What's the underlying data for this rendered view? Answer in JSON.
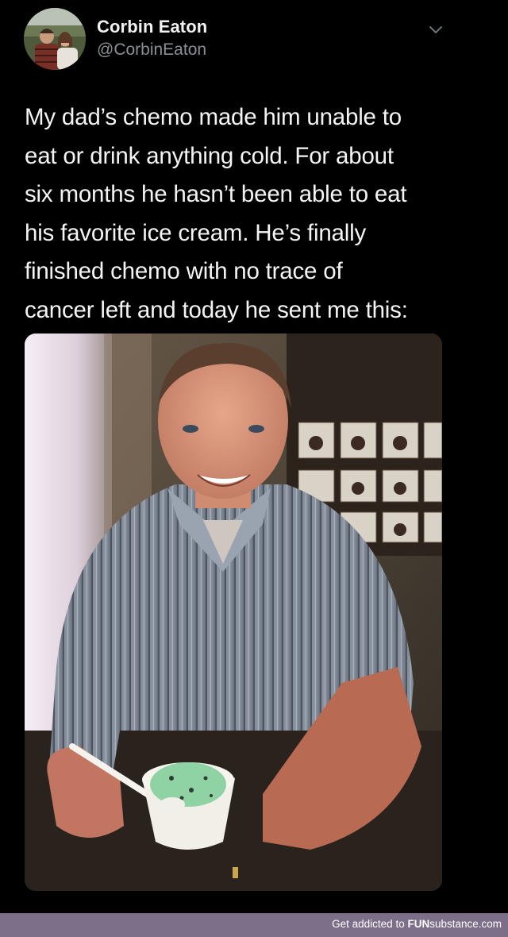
{
  "tweet": {
    "author_name": "Corbin Eaton",
    "author_handle": "@CorbinEaton",
    "text": "My dad’s chemo made him unable to\neat or drink anything cold. For about\nsix months he hasn’t been able to eat\nhis favorite ice cream. He’s finally\nfinished chemo with no trace of\ncancer left and today he sent me this:",
    "avatar_icon": "couple-photo-avatar",
    "menu_icon": "chevron-down-icon"
  },
  "watermark": {
    "prefix": "Get addicted to ",
    "brand_bold": "FUN",
    "brand_rest": "substance.com"
  },
  "colors": {
    "background": "#000000",
    "text": "#f4f4f4",
    "handle": "#8b9096",
    "footer_bar": "#7d6e8a"
  }
}
